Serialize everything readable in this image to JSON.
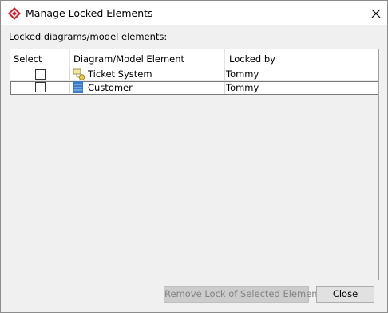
{
  "window": {
    "title": "Manage Locked Elements"
  },
  "section_label": "Locked diagrams/model elements:",
  "table": {
    "columns": [
      "Select",
      "Diagram/Model Element",
      "Locked by"
    ],
    "rows": [
      {
        "selected": false,
        "icon": "diagram-icon",
        "element": "Ticket System",
        "locked_by": "Tommy"
      },
      {
        "selected": false,
        "icon": "class-icon",
        "element": "Customer",
        "locked_by": "Tommy"
      }
    ]
  },
  "buttons": {
    "remove_lock": "Remove Lock of Selected Elements",
    "close": "Close"
  },
  "colors": {
    "app_icon": "#d0212f",
    "class_icon": "#3b7cc6",
    "diagram_icon": "#e6c84a"
  }
}
